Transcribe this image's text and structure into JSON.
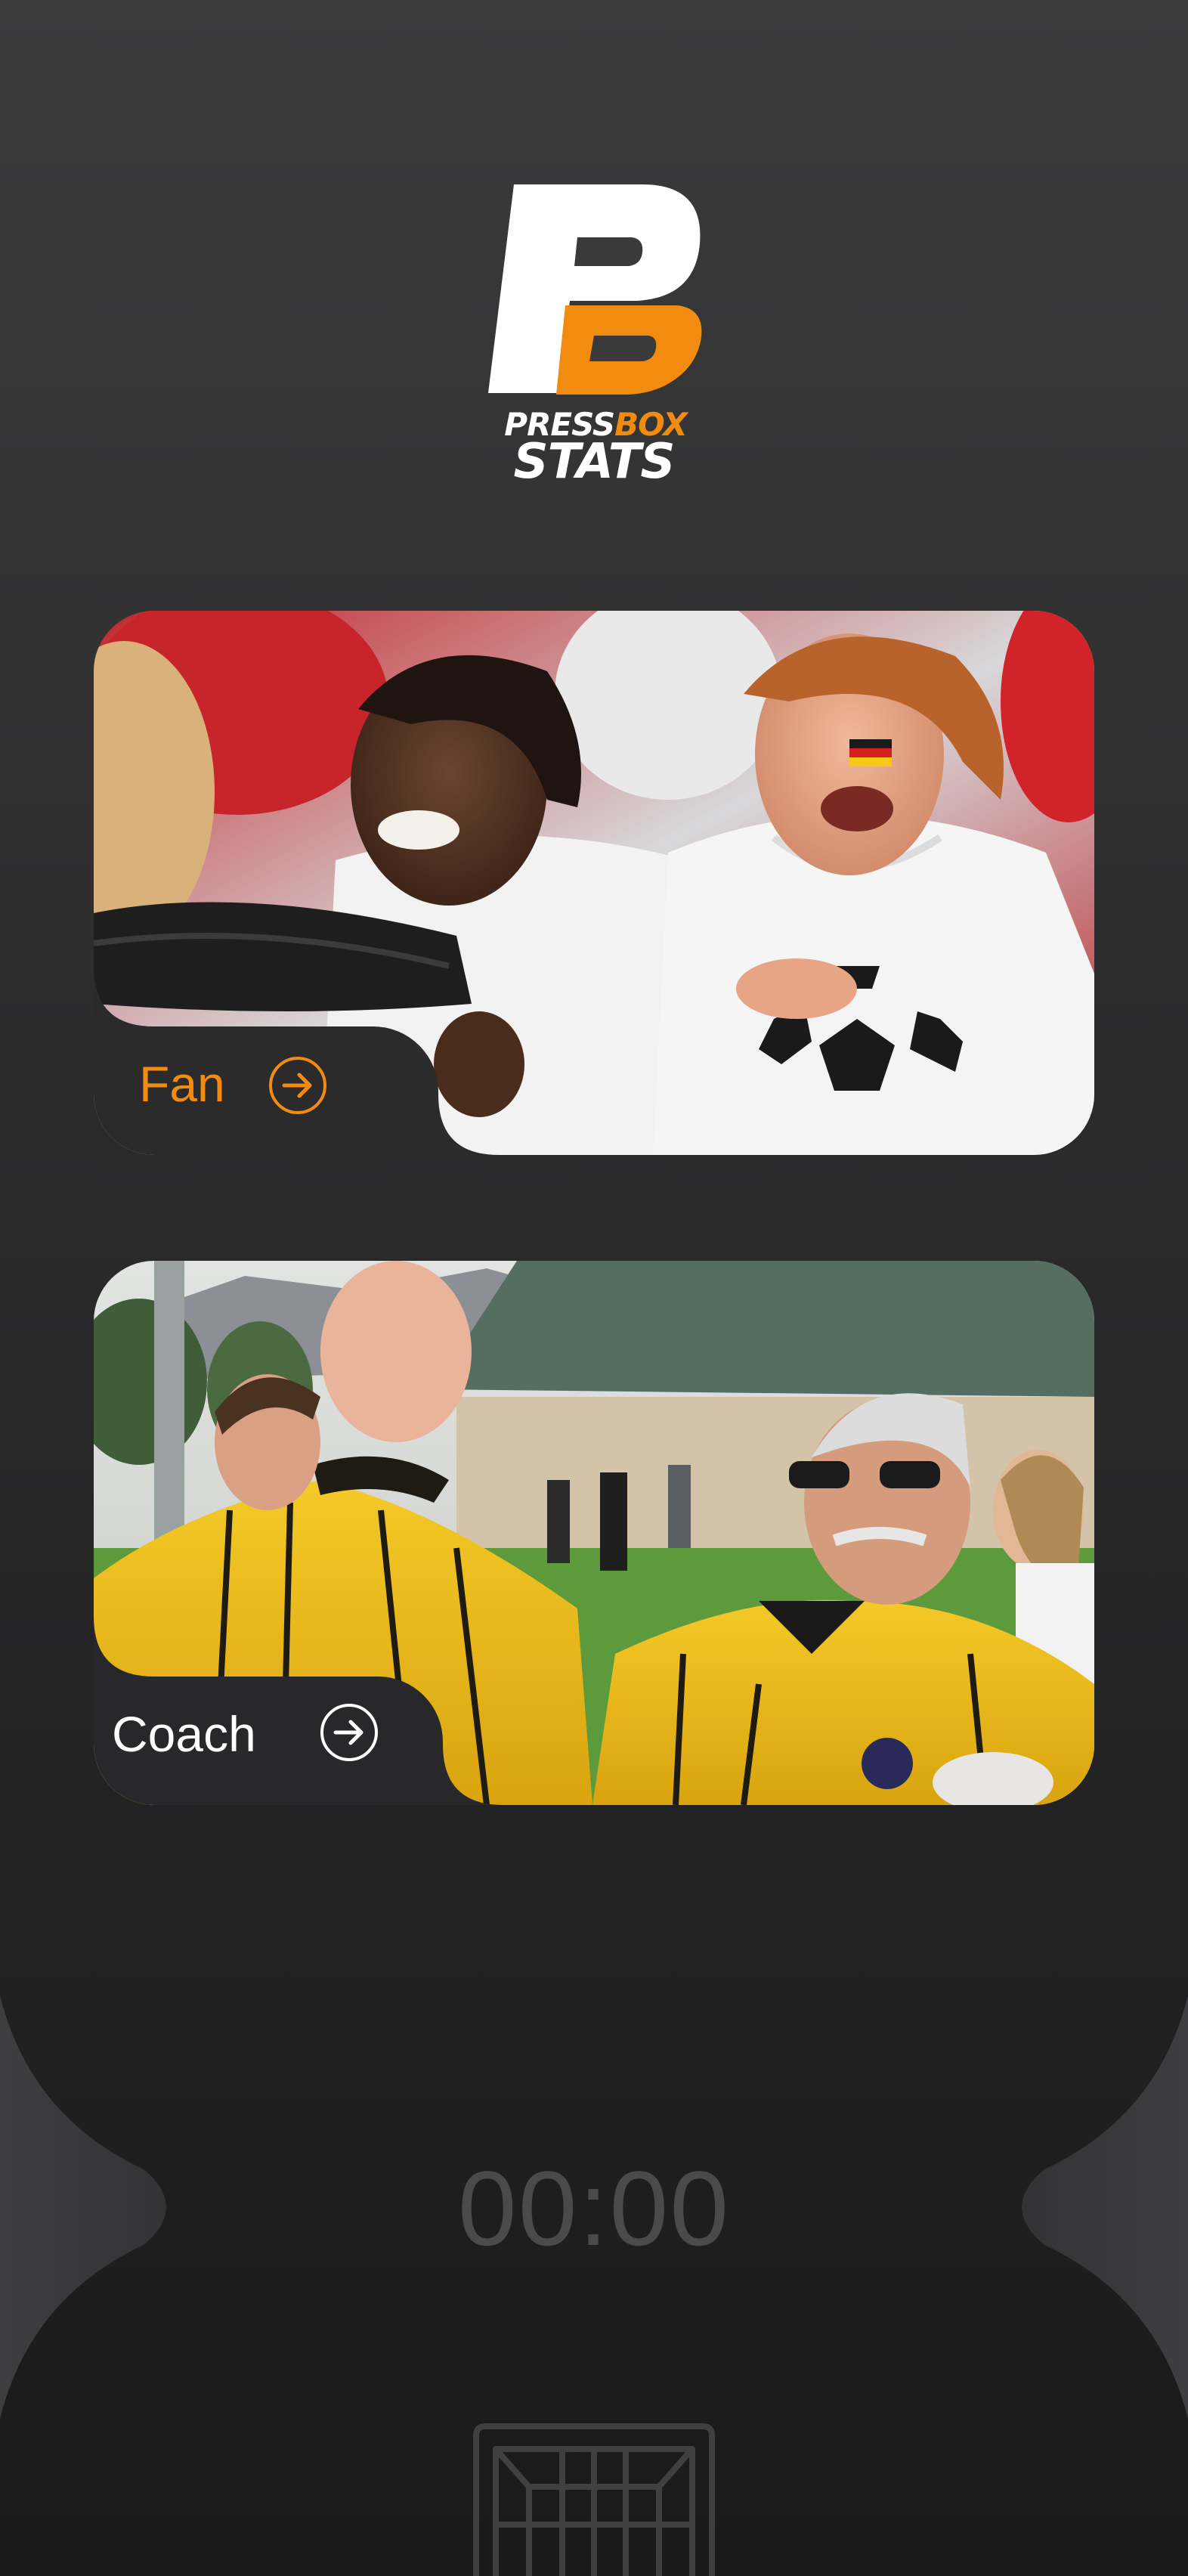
{
  "brand": {
    "logo_line1_part1": "PRESS",
    "logo_line1_part2": "BOX",
    "logo_line2": "STATS",
    "accent_color": "#f28c10"
  },
  "roles": [
    {
      "label": "Fan",
      "label_color": "#f28c10",
      "icon": "arrow-right-circle-icon",
      "image_description_icon": "fan-crowd-photo"
    },
    {
      "label": "Coach",
      "label_color": "#ffffff",
      "icon": "arrow-right-circle-icon",
      "image_description_icon": "referee-coach-photo"
    }
  ],
  "timer": {
    "value": "00:00"
  },
  "footer": {
    "icon": "soccer-goal-icon"
  }
}
